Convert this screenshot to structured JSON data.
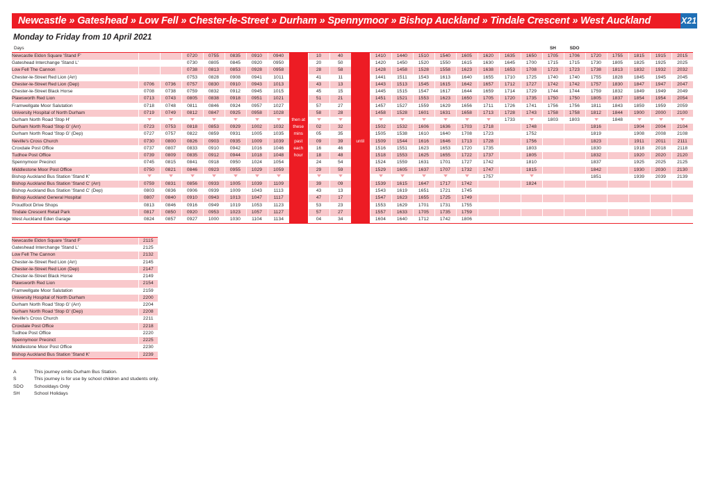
{
  "header": {
    "route_title": "Newcastle » Gateshead » Low Fell » Chester-le-Street » Durham » Spennymoor » Bishop Auckland » Tindale Crescent » West Auckland",
    "service_number": "X21",
    "subtitle": "Monday to Friday from 10 April 2021",
    "bar_color": "#ED1C24",
    "badge_color": "#1F6FB5"
  },
  "table": {
    "days_label": "Days",
    "col_notes": {
      "sh": "SH",
      "sdo": "SDO"
    },
    "band_labels": {
      "then_at": "then at",
      "these": "these",
      "mins": "mins",
      "past": "past",
      "each": "each",
      "hour": "hour",
      "until": "until"
    },
    "stops": [
      "Newcastle Eldon Square 'Stand F'",
      "Gateshead Interchange 'Stand L'",
      "Low Fell The Cannon",
      "Chester-le-Street Red Lion (Arr)",
      "Chester-le-Street Red Lion (Dep)",
      "Chester-le-Street Black Horse",
      "Plawsworth Red Lion",
      "Framwellgate Moor Salutation",
      "University Hospital of North Durham",
      "Durham North Road 'Stop H'",
      "Durham North Road 'Stop G' (Arr)",
      "Durham North Road 'Stop G' (Dep)",
      "Neville's Cross Church",
      "Croxdale Post Office",
      "Tudhoe Post Office",
      "Spennymoor Precinct",
      "Middlestone Moor Post Office",
      "Bishop Auckland Bus Station 'Stand K'",
      "Bishop Auckland Bus Station 'Stand C' (Arr)",
      "Bishop Auckland Bus Station 'Stand C' (Dep)",
      "Bishop Auckland General Hospital",
      "Proudfoot Drive Shops",
      "Tindale Crescent Retail Park",
      "West Auckland Eden Garage"
    ],
    "rows": [
      [
        "",
        "",
        "0720",
        "0755",
        "0835",
        "0910",
        "0940",
        "10",
        "40",
        "1410",
        "1440",
        "1510",
        "1540",
        "1605",
        "1620",
        "1635",
        "1650",
        "1705",
        "1706",
        "1720",
        "1755",
        "1815",
        "1915",
        "2015"
      ],
      [
        "",
        "",
        "0730",
        "0805",
        "0845",
        "0920",
        "0950",
        "20",
        "50",
        "1420",
        "1450",
        "1520",
        "1550",
        "1615",
        "1630",
        "1645",
        "1700",
        "1715",
        "1715",
        "1730",
        "1805",
        "1825",
        "1925",
        "2025"
      ],
      [
        "",
        "",
        "0738",
        "0813",
        "0853",
        "0928",
        "0958",
        "28",
        "58",
        "1428",
        "1458",
        "1528",
        "1558",
        "1623",
        "1638",
        "1653",
        "1708",
        "1723",
        "1723",
        "1738",
        "1813",
        "1832",
        "1932",
        "2032"
      ],
      [
        "",
        "",
        "0753",
        "0828",
        "0908",
        "0941",
        "1011",
        "41",
        "11",
        "1441",
        "1511",
        "1543",
        "1613",
        "1640",
        "1655",
        "1710",
        "1725",
        "1740",
        "1740",
        "1755",
        "1828",
        "1845",
        "1945",
        "2045"
      ],
      [
        "0706",
        "0736",
        "0757",
        "0830",
        "0910",
        "0943",
        "1013",
        "43",
        "13",
        "1443",
        "1513",
        "1545",
        "1615",
        "1642",
        "1657",
        "1712",
        "1727",
        "1742",
        "1742",
        "1757",
        "1830",
        "1847",
        "1947",
        "2047"
      ],
      [
        "0708",
        "0738",
        "0759",
        "0832",
        "0912",
        "0945",
        "1015",
        "45",
        "15",
        "1445",
        "1515",
        "1547",
        "1617",
        "1644",
        "1659",
        "1714",
        "1729",
        "1744",
        "1744",
        "1759",
        "1832",
        "1849",
        "1949",
        "2049"
      ],
      [
        "0713",
        "0743",
        "0805",
        "0838",
        "0918",
        "0951",
        "1021",
        "51",
        "21",
        "1451",
        "1521",
        "1553",
        "1623",
        "1650",
        "1705",
        "1720",
        "1735",
        "1750",
        "1750",
        "1805",
        "1837",
        "1854",
        "1954",
        "2054"
      ],
      [
        "0718",
        "0748",
        "0811",
        "0846",
        "0924",
        "0957",
        "1027",
        "57",
        "27",
        "1457",
        "1527",
        "1559",
        "1629",
        "1656",
        "1711",
        "1726",
        "1741",
        "1756",
        "1756",
        "1811",
        "1843",
        "1859",
        "1959",
        "2059"
      ],
      [
        "0719",
        "0749",
        "0812",
        "0847",
        "0925",
        "0958",
        "1028",
        "58",
        "28",
        "1458",
        "1528",
        "1601",
        "1631",
        "1658",
        "1713",
        "1728",
        "1743",
        "1758",
        "1758",
        "1812",
        "1844",
        "1900",
        "2000",
        "2100"
      ],
      [
        "▼",
        "▼",
        "▼",
        "▼",
        "▼",
        "▼",
        "▼",
        "▼",
        "▼",
        "▼",
        "▼",
        "▼",
        "▼",
        "▼",
        "▼",
        "1733",
        "▼",
        "1803",
        "1803",
        "▼",
        "1848",
        "▼",
        "▼",
        "▼"
      ],
      [
        "0723",
        "0753",
        "0818",
        "0853",
        "0929",
        "1002",
        "1032",
        "02",
        "32",
        "1502",
        "1532",
        "1606",
        "1636",
        "1703",
        "1718",
        "",
        "1748",
        "",
        "",
        "1816",
        "",
        "1904",
        "2004",
        "2104"
      ],
      [
        "0727",
        "0757",
        "0822",
        "0859",
        "0931",
        "1005",
        "1035",
        "05",
        "35",
        "1505",
        "1538",
        "1610",
        "1640",
        "1708",
        "1723",
        "",
        "1752",
        "",
        "",
        "1819",
        "",
        "1908",
        "2008",
        "2108"
      ],
      [
        "0730",
        "0800",
        "0826",
        "0903",
        "0935",
        "1009",
        "1039",
        "09",
        "39",
        "1509",
        "1544",
        "1616",
        "1646",
        "1713",
        "1728",
        "",
        "1756",
        "",
        "",
        "1823",
        "",
        "1911",
        "2011",
        "2111"
      ],
      [
        "0737",
        "0807",
        "0833",
        "0910",
        "0942",
        "1016",
        "1046",
        "16",
        "46",
        "1516",
        "1551",
        "1623",
        "1653",
        "1720",
        "1735",
        "",
        "1803",
        "",
        "",
        "1830",
        "",
        "1918",
        "2018",
        "2118"
      ],
      [
        "0739",
        "0809",
        "0835",
        "0912",
        "0944",
        "1018",
        "1048",
        "18",
        "48",
        "1518",
        "1553",
        "1625",
        "1655",
        "1722",
        "1737",
        "",
        "1805",
        "",
        "",
        "1832",
        "",
        "1920",
        "2020",
        "2120"
      ],
      [
        "0745",
        "0815",
        "0841",
        "0918",
        "0950",
        "1024",
        "1054",
        "24",
        "54",
        "1524",
        "1559",
        "1631",
        "1701",
        "1727",
        "1742",
        "",
        "1810",
        "",
        "",
        "1837",
        "",
        "1925",
        "2025",
        "2125"
      ],
      [
        "0750",
        "0821",
        "0846",
        "0923",
        "0955",
        "1029",
        "1059",
        "29",
        "59",
        "1529",
        "1605",
        "1637",
        "1707",
        "1732",
        "1747",
        "",
        "1815",
        "",
        "",
        "1842",
        "",
        "1930",
        "2030",
        "2130"
      ],
      [
        "▼",
        "▼",
        "▼",
        "▼",
        "▼",
        "▼",
        "▼",
        "▼",
        "▼",
        "▼",
        "▼",
        "▼",
        "▼",
        "▼",
        "1757",
        "",
        "▼",
        "",
        "",
        "1851",
        "",
        "1939",
        "2039",
        "2139"
      ],
      [
        "0759",
        "0831",
        "0856",
        "0933",
        "1005",
        "1039",
        "1109",
        "39",
        "09",
        "1539",
        "1615",
        "1647",
        "1717",
        "1742",
        "",
        "",
        "1824",
        "",
        "",
        "",
        "",
        "",
        "",
        ""
      ],
      [
        "0803",
        "0836",
        "0906",
        "0939",
        "1009",
        "1043",
        "1113",
        "43",
        "13",
        "1543",
        "1619",
        "1651",
        "1721",
        "1745",
        "",
        "",
        "",
        "",
        "",
        "",
        "",
        "",
        "",
        ""
      ],
      [
        "0807",
        "0840",
        "0910",
        "0943",
        "1013",
        "1047",
        "1117",
        "47",
        "17",
        "1547",
        "1623",
        "1655",
        "1725",
        "1749",
        "",
        "",
        "",
        "",
        "",
        "",
        "",
        "",
        "",
        ""
      ],
      [
        "0813",
        "0846",
        "0916",
        "0949",
        "1019",
        "1053",
        "1123",
        "53",
        "23",
        "1553",
        "1629",
        "1701",
        "1731",
        "1755",
        "",
        "",
        "",
        "",
        "",
        "",
        "",
        "",
        "",
        ""
      ],
      [
        "0817",
        "0850",
        "0920",
        "0953",
        "1023",
        "1057",
        "1127",
        "57",
        "27",
        "1557",
        "1633",
        "1705",
        "1735",
        "1759",
        "",
        "",
        "",
        "",
        "",
        "",
        "",
        "",
        "",
        ""
      ],
      [
        "0824",
        "0857",
        "0927",
        "1000",
        "1030",
        "1104",
        "1134",
        "04",
        "34",
        "1604",
        "1640",
        "1712",
        "1742",
        "1806",
        "",
        "",
        "",
        "",
        "",
        "",
        "",
        "",
        "",
        ""
      ]
    ]
  },
  "table2": {
    "stops": [
      "Newcastle Eldon Square 'Stand F'",
      "Gateshead Interchange 'Stand L'",
      "Low Fell The Cannon",
      "Chester-le-Street Red Lion (Arr)",
      "Chester-le-Street Red Lion (Dep)",
      "Chester-le-Street Black Horse",
      "Plawsworth Red Lion",
      "Framwellgate Moor Salutation",
      "University Hospital of North Durham",
      "Durham North Road 'Stop G' (Arr)",
      "Durham North Road 'Stop G' (Dep)",
      "Neville's Cross Church",
      "Croxdale Post Office",
      "Tudhoe Post Office",
      "Spennymoor Precinct",
      "Middlestone Moor Post Office",
      "Bishop Auckland Bus Station 'Stand K'"
    ],
    "times": [
      "2115",
      "2125",
      "2132",
      "2145",
      "2147",
      "2149",
      "2154",
      "2159",
      "2200",
      "2204",
      "2208",
      "2211",
      "2218",
      "2220",
      "2225",
      "2230",
      "2239"
    ]
  },
  "notes": [
    {
      "code": "A",
      "text": "This journey omits Durham Bus Station."
    },
    {
      "code": "S",
      "text": "This journey is for use by school children and students only."
    },
    {
      "code": "SDO",
      "text": "Schooldays Only"
    },
    {
      "code": "SH",
      "text": "School Holidays"
    }
  ]
}
